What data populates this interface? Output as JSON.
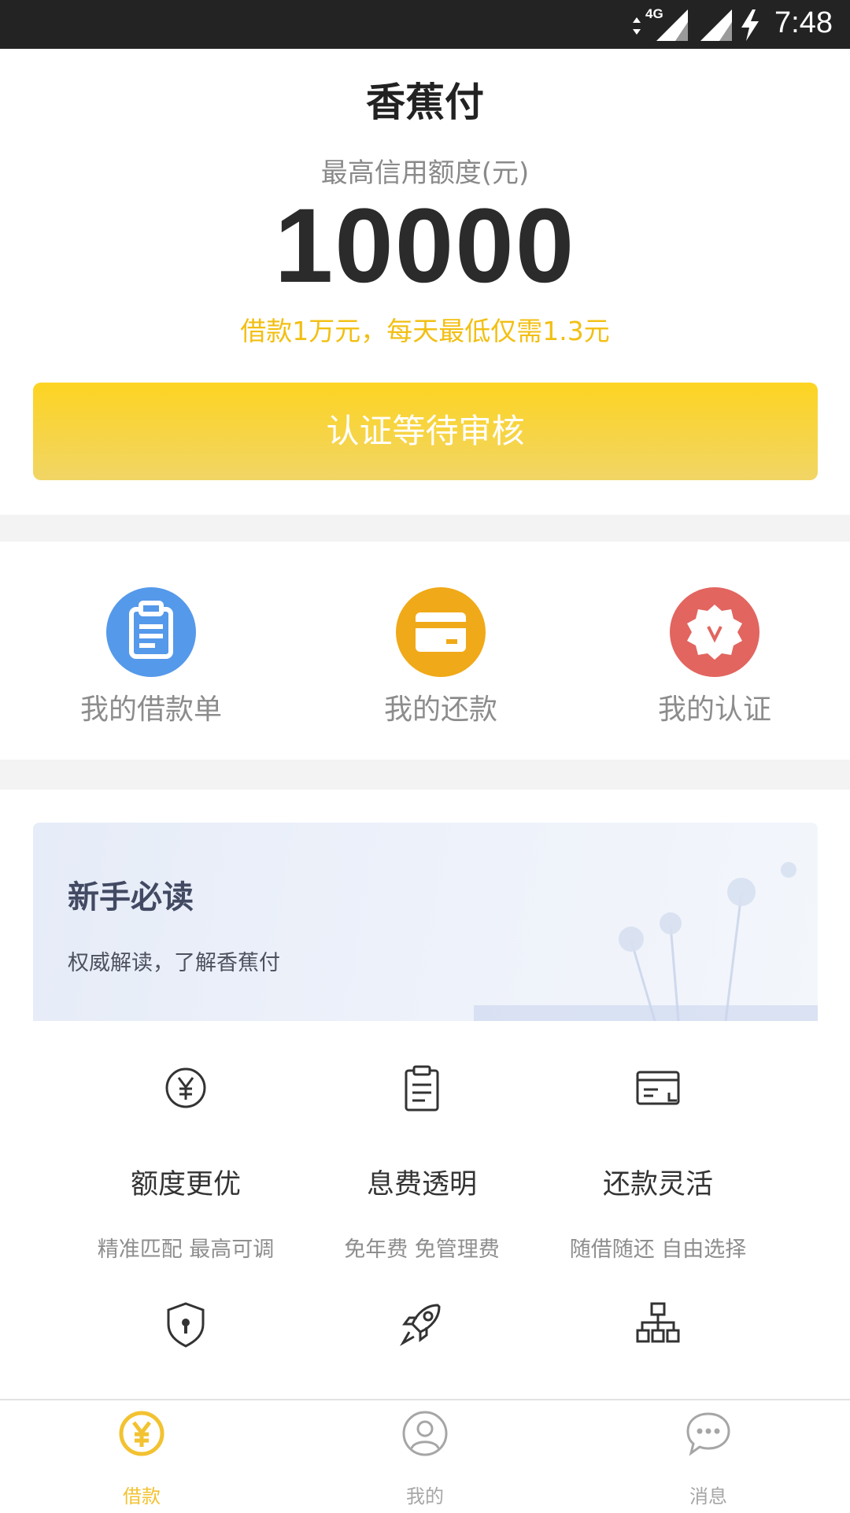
{
  "status_bar": {
    "time": "7:48",
    "network": "4G",
    "icons": [
      "data-arrows-icon",
      "signal-4g-icon",
      "signal-icon",
      "charging-bolt-icon"
    ]
  },
  "header": {
    "title": "香蕉付"
  },
  "credit": {
    "label": "最高信用额度(元)",
    "amount": "10000",
    "promo": "借款1万元，每天最低仅需1.3元"
  },
  "cta": {
    "label": "认证等待审核"
  },
  "quick_actions": [
    {
      "label": "我的借款单",
      "icon": "clipboard-icon",
      "color": "#5599ea"
    },
    {
      "label": "我的还款",
      "icon": "card-icon",
      "color": "#f0a918"
    },
    {
      "label": "我的认证",
      "icon": "verified-badge-icon",
      "color": "#e2655f"
    }
  ],
  "banner": {
    "title": "新手必读",
    "subtitle": "权威解读，了解香蕉付"
  },
  "features": [
    {
      "icon": "yuan-coin-icon",
      "title": "额度更优",
      "desc": "精准匹配 最高可调"
    },
    {
      "icon": "document-icon",
      "title": "息费透明",
      "desc": "免年费 免管理费"
    },
    {
      "icon": "card-refund-icon",
      "title": "还款灵活",
      "desc": "随借随还 自由选择"
    },
    {
      "icon": "shield-lock-icon",
      "title": "",
      "desc": ""
    },
    {
      "icon": "rocket-icon",
      "title": "",
      "desc": ""
    },
    {
      "icon": "org-chart-icon",
      "title": "",
      "desc": ""
    }
  ],
  "tabbar": {
    "tabs": [
      {
        "label": "借款",
        "icon": "yuan-icon",
        "active": true
      },
      {
        "label": "我的",
        "icon": "user-icon",
        "active": false
      },
      {
        "label": "消息",
        "icon": "chat-icon",
        "active": false
      }
    ]
  },
  "colors": {
    "accent": "#f2c230",
    "cta_top": "#fdd422",
    "cta_bottom": "#f1d565",
    "promo_text": "#f2bf12",
    "status_bar": "#232323"
  }
}
